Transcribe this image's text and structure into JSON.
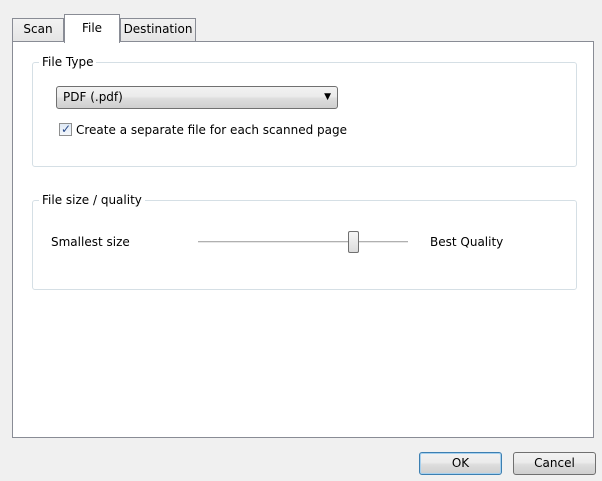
{
  "tabs": [
    {
      "label": "Scan",
      "active": false
    },
    {
      "label": "File",
      "active": true
    },
    {
      "label": "Destination",
      "active": false
    }
  ],
  "file_type": {
    "legend": "File Type",
    "selected": "PDF (.pdf)",
    "separate_file": {
      "label": "Create a separate file for each scanned page",
      "checked": true
    }
  },
  "quality": {
    "legend": "File size / quality",
    "min_label": "Smallest size",
    "max_label": "Best Quality",
    "level_percent": 74
  },
  "buttons": {
    "ok": "OK",
    "cancel": "Cancel"
  },
  "icons": {
    "dropdown": "chevron-down-icon",
    "check": "checkmark-icon"
  }
}
